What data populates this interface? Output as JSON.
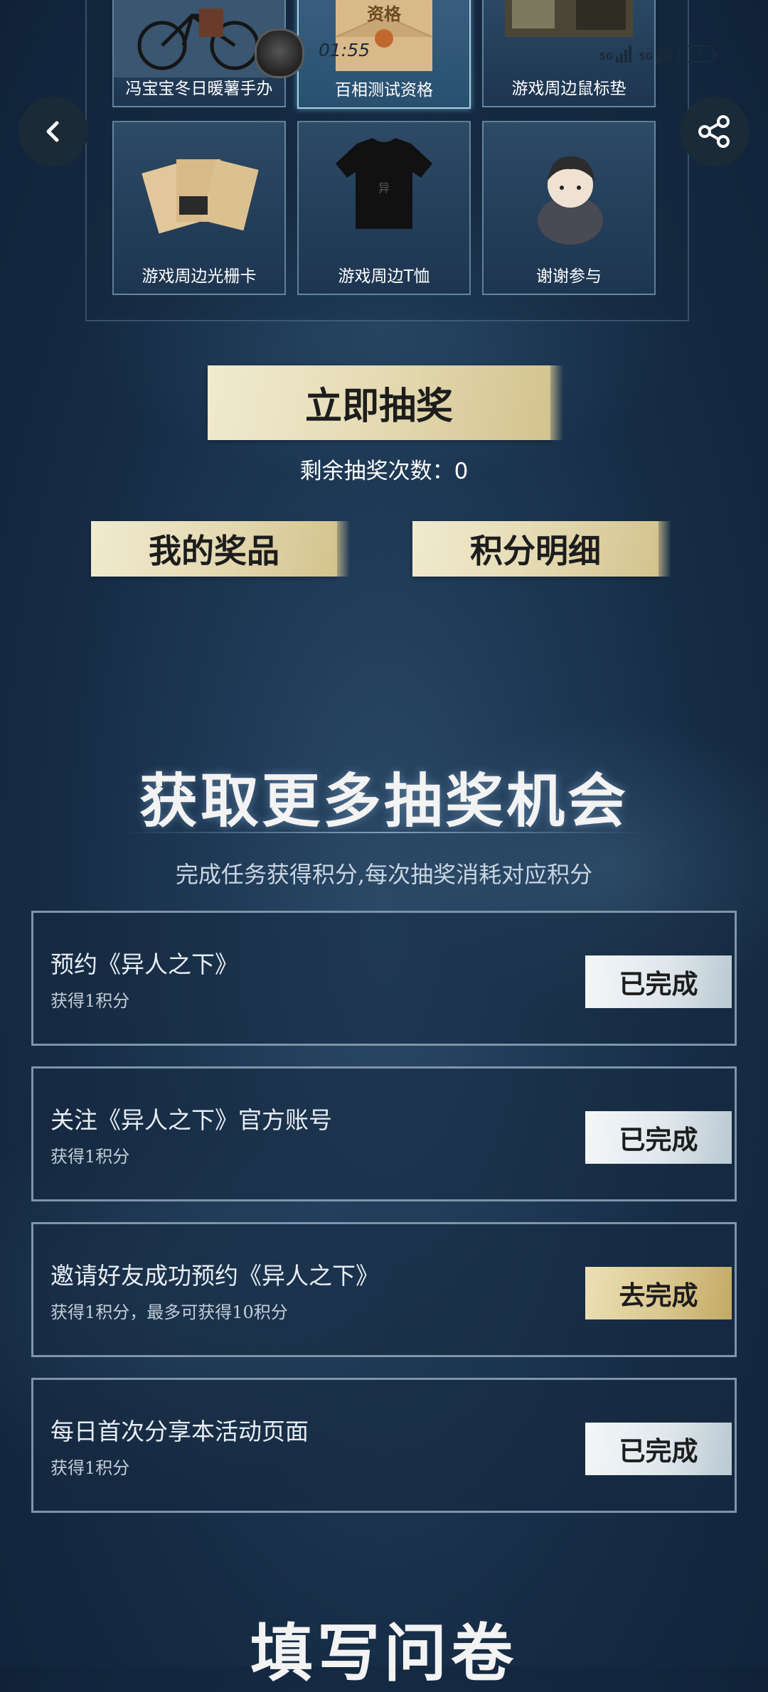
{
  "status_bar": {
    "time": "01:55",
    "network_1": "5G",
    "network_2": "5G",
    "battery": "37"
  },
  "nav": {
    "back_icon": "chevron-left-icon",
    "share_icon": "share-icon"
  },
  "prizes": [
    {
      "label": "冯宝宝冬日暖薯手办"
    },
    {
      "label": "百相测试资格",
      "image_text": "资格"
    },
    {
      "label": "游戏周边鼠标垫"
    },
    {
      "label": "游戏周边光栅卡"
    },
    {
      "label": "游戏周边T恤"
    },
    {
      "label": "谢谢参与"
    }
  ],
  "draw": {
    "button": "立即抽奖",
    "remaining": "剩余抽奖次数：0"
  },
  "actions": {
    "my_prizes": "我的奖品",
    "points_detail": "积分明细"
  },
  "more_chances": {
    "title": "获取更多抽奖机会",
    "subtitle": "完成任务获得积分,每次抽奖消耗对应积分"
  },
  "tasks": [
    {
      "title": "预约《异人之下》",
      "reward": "获得1积分",
      "button": "已完成",
      "state": "done"
    },
    {
      "title": "关注《异人之下》官方账号",
      "reward": "获得1积分",
      "button": "已完成",
      "state": "done"
    },
    {
      "title": "邀请好友成功预约《异人之下》",
      "reward": "获得1积分，最多可获得10积分",
      "button": "去完成",
      "state": "todo"
    },
    {
      "title": "每日首次分享本活动页面",
      "reward": "获得1积分",
      "button": "已完成",
      "state": "done"
    }
  ],
  "questionnaire": {
    "title": "填写问卷"
  },
  "colors": {
    "gold": "#e6dcb6",
    "silver": "#dfe7ec",
    "background": "#1f3a57"
  }
}
